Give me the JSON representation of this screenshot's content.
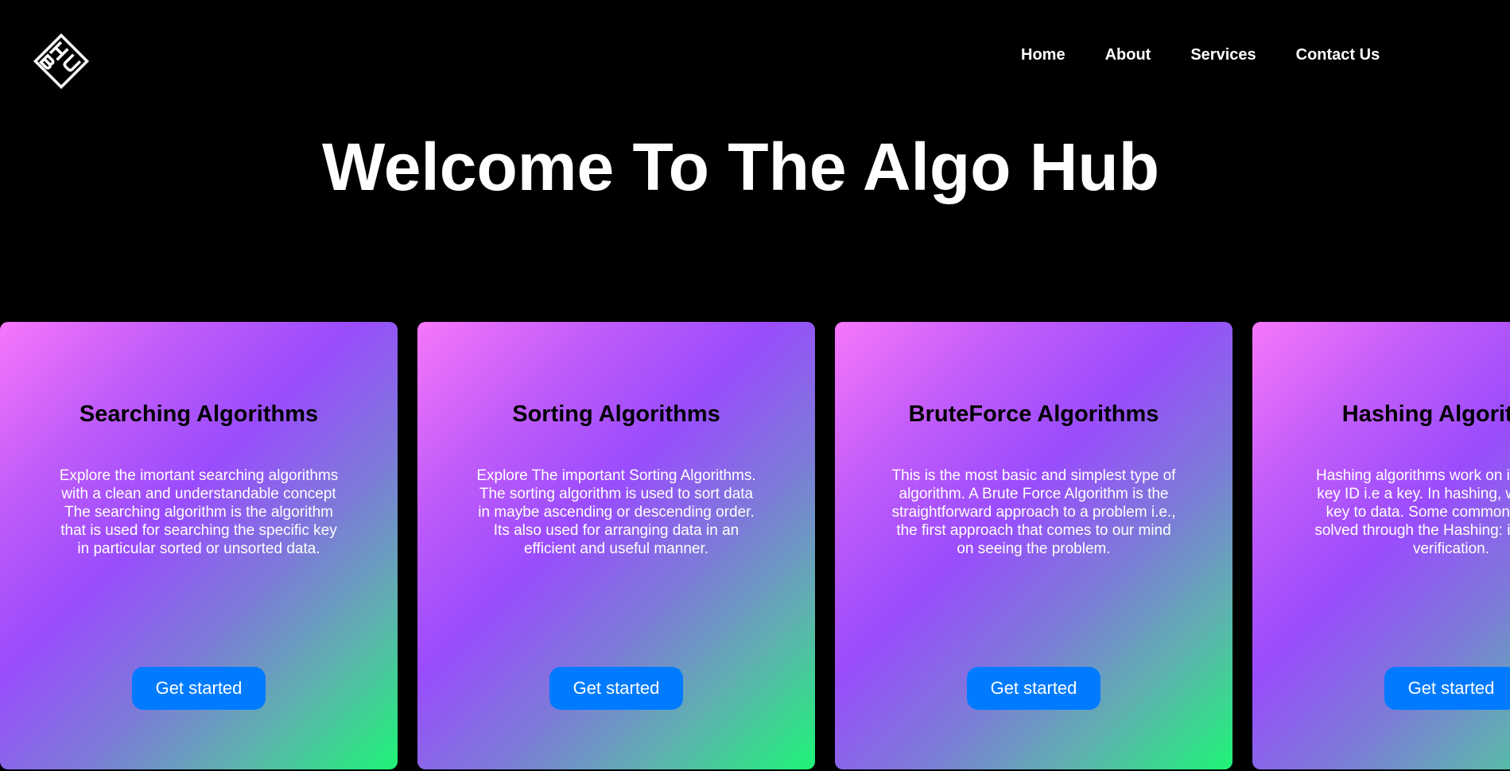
{
  "header": {
    "logo_icon": "hub-logo-icon",
    "logo_text": "HUB",
    "nav": {
      "home": "Home",
      "about": "About",
      "services": "Services",
      "contact": "Contact Us"
    }
  },
  "hero": {
    "title": "Welcome To The Algo Hub"
  },
  "cards": [
    {
      "title": "Searching Algorithms",
      "description": "Explore the imortant searching algorithms with a clean and understandable concept The searching algorithm is the algorithm that is used for searching the specific key in particular sorted or unsorted data.",
      "button": "Get started"
    },
    {
      "title": "Sorting Algorithms",
      "description": "Explore The important Sorting Algorithms. The sorting algorithm is used to sort data in maybe ascending or descending order. Its also used for arranging data in an efficient and useful manner.",
      "button": "Get started"
    },
    {
      "title": "BruteForce Algorithms",
      "description": "This is the most basic and simplest type of algorithm. A Brute Force Algorithm is the straightforward approach to a problem i.e., the first approach that comes to our mind on seeing the problem.",
      "button": "Get started"
    },
    {
      "title": "Hashing Algorithms",
      "description": "Hashing algorithms work on index with a key ID i.e a key. In hashing, we assign a key to data. Some common problems solved through the Hashing: in password verification.",
      "button": "Get started"
    }
  ],
  "colors": {
    "background": "#000000",
    "button": "#007bff",
    "gradient_start": "#f677fb",
    "gradient_mid": "#9a4cfd",
    "gradient_end": "#1ef476"
  }
}
